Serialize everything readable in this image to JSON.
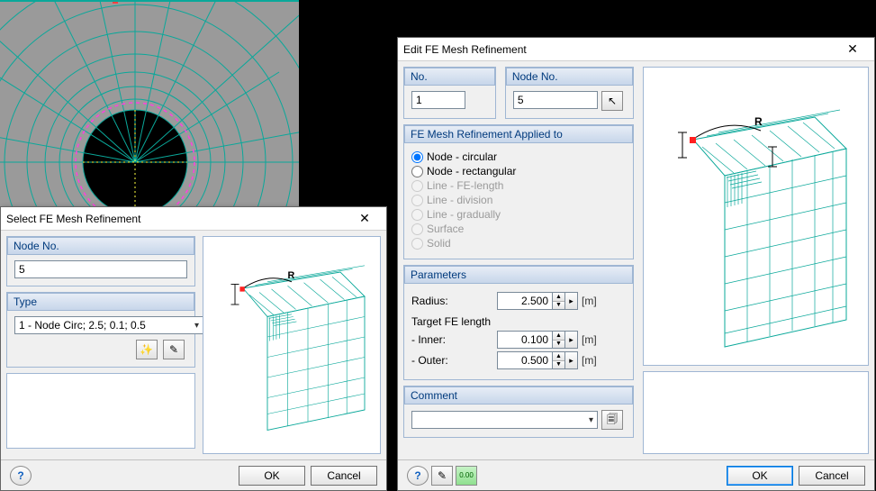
{
  "select_dialog": {
    "title": "Select FE Mesh Refinement",
    "node_no_label": "Node No.",
    "node_no_value": "5",
    "type_label": "Type",
    "type_value": "1 - Node Circ; 2.5; 0.1; 0.5",
    "btn_open": "📂",
    "btn_save": "💾",
    "ok": "OK",
    "cancel": "Cancel",
    "help": "?"
  },
  "edit_dialog": {
    "title": "Edit FE Mesh Refinement",
    "no_label": "No.",
    "no_value": "1",
    "node_no_label": "Node No.",
    "node_no_value": "5",
    "pick": "↗",
    "applied_label": "FE Mesh Refinement Applied to",
    "radios": {
      "node_circular": "Node - circular",
      "node_rectangular": "Node - rectangular",
      "line_felength": "Line - FE-length",
      "line_division": "Line - division",
      "line_gradually": "Line - gradually",
      "surface": "Surface",
      "solid": "Solid"
    },
    "parameters_label": "Parameters",
    "radius_label": "Radius:",
    "radius_value": "2.500",
    "target_label": "Target FE length",
    "inner_label": "- Inner:",
    "inner_value": "0.100",
    "outer_label": "- Outer:",
    "outer_value": "0.500",
    "unit_m": "[m]",
    "comment_label": "Comment",
    "comment_value": "",
    "ok": "OK",
    "cancel": "Cancel",
    "help": "?"
  }
}
